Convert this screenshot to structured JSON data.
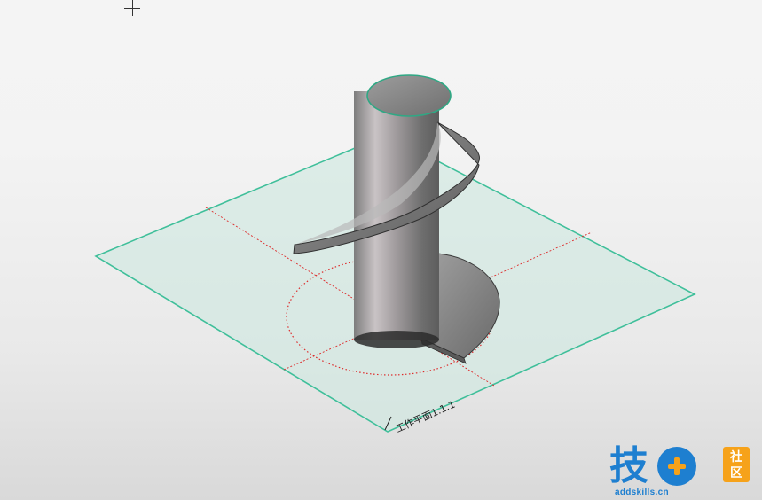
{
  "viewport": {
    "workplane_label": "工作平面1.1.1"
  },
  "watermark": {
    "main_char": "技",
    "tag_top": "社",
    "tag_bottom": "区",
    "url": "addskills.cn"
  },
  "colors": {
    "background_top": "#f4f4f4",
    "background_bottom": "#d9d9d9",
    "plane_fill": "#cfe8e0",
    "plane_edge": "#3fbf9a",
    "guide_line": "#dd2b2b",
    "solid_body": "#8f8f8f",
    "watermark_blue": "#1e7fd0",
    "watermark_orange": "#f6a21a"
  },
  "icons": [
    "crosshair-cursor-icon"
  ]
}
